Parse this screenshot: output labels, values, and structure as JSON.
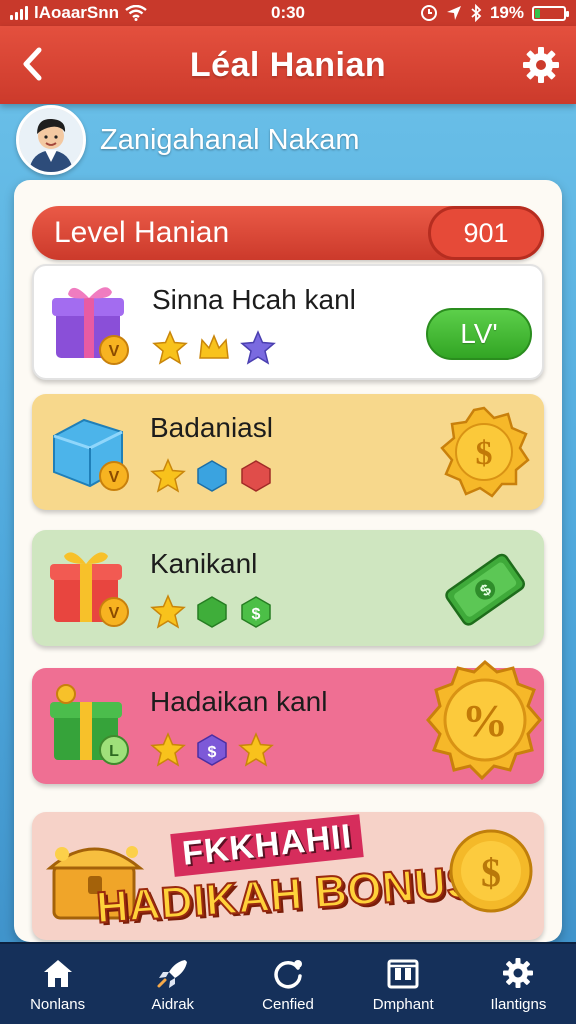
{
  "status_bar": {
    "carrier": "lAoaarSnn",
    "time": "0:30",
    "battery": "19%",
    "battery_level": 0.19
  },
  "header": {
    "title": "Léal Hanian"
  },
  "user": {
    "name": "Zanigahanal Nakam"
  },
  "level": {
    "title": "Level Hanian",
    "value": "901"
  },
  "tasks": [
    {
      "title": "Sinna Hcah kanl",
      "button": "LV'",
      "stars_filled": 3
    },
    {
      "title": "Badaniasl",
      "stars_filled": 3
    },
    {
      "title": "Kanikanl",
      "stars_filled": 3
    },
    {
      "title": "Hadaikan kanl",
      "stars_filled": 3
    }
  ],
  "bonus": {
    "pretitle": "FKKHAHII",
    "title": "HADIKAH BONUS!"
  },
  "nav": [
    {
      "label": "Nonlans",
      "icon": "home-icon"
    },
    {
      "label": "Aidrak",
      "icon": "rocket-icon"
    },
    {
      "label": "Cenfied",
      "icon": "refresh-icon"
    },
    {
      "label": "Dmphant",
      "icon": "calendar-icon"
    },
    {
      "label": "Ilantigns",
      "icon": "gear-icon"
    }
  ],
  "colors": {
    "header_red": "#cc3a2b",
    "card_yellow": "#f7d88c",
    "card_green": "#cfe6c0",
    "card_pink": "#ef6f93",
    "nav_bg": "#15305a",
    "accent_green": "#32a524"
  }
}
